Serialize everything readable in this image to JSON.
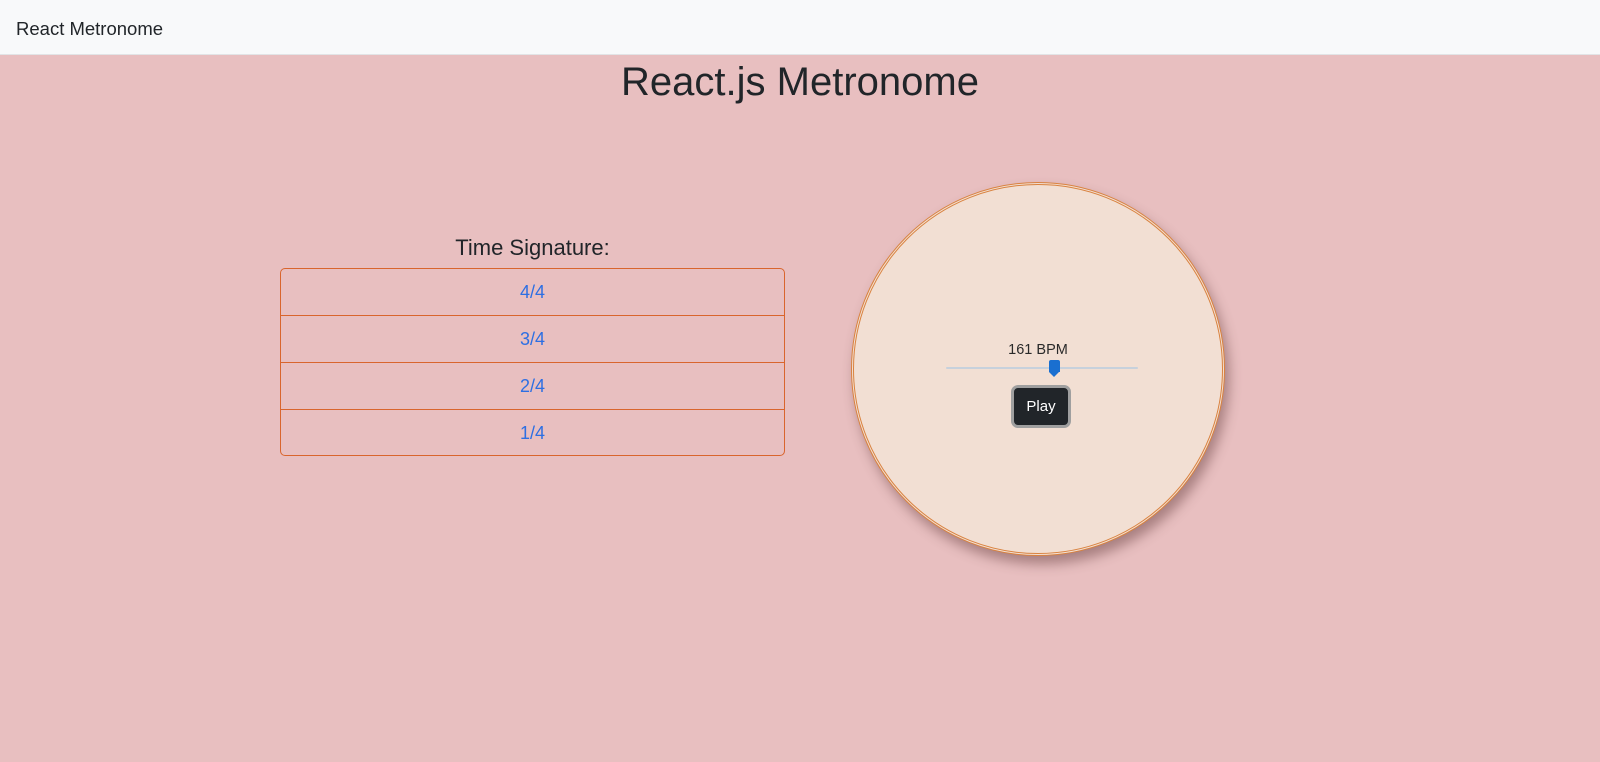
{
  "navbar": {
    "brand": "React Metronome"
  },
  "page": {
    "title": "React.js Metronome"
  },
  "time_signature": {
    "label": "Time Signature:",
    "options": [
      "4/4",
      "3/4",
      "2/4",
      "1/4"
    ]
  },
  "metronome": {
    "bpm_label": "161 BPM",
    "bpm_slider_fraction": 0.56,
    "play_label": "Play"
  },
  "colors": {
    "background": "#e8bfc0",
    "accent_border": "#d9652d",
    "link": "#2d6fe3",
    "dial_fill": "#f2dfd3",
    "slider_thumb": "#1a6fd0",
    "button": "#212529"
  }
}
